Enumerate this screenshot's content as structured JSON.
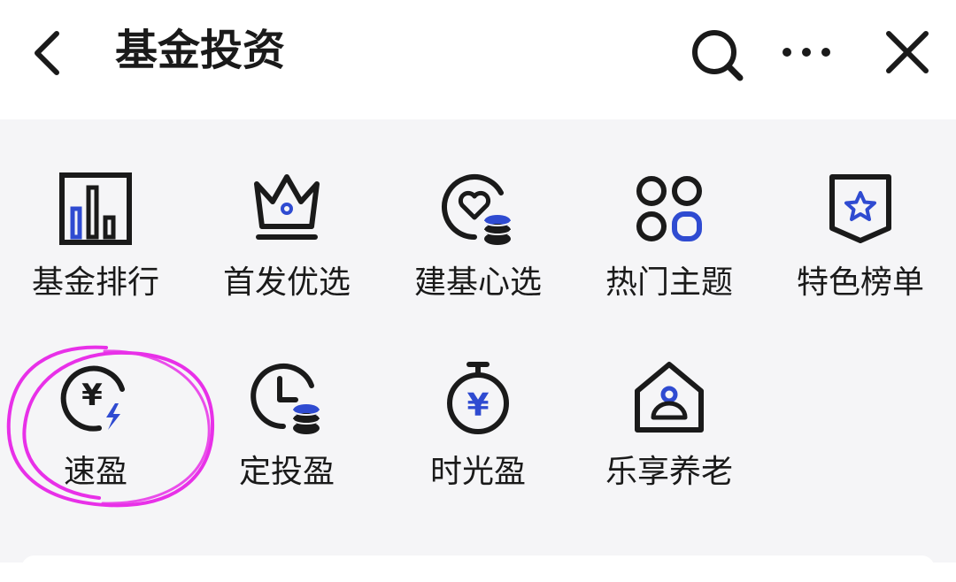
{
  "header": {
    "title": "基金投资",
    "back_icon": "chevron-left-icon",
    "search_icon": "search-icon",
    "more_icon": "more-dots-icon",
    "close_icon": "close-icon"
  },
  "colors": {
    "icon_dark": "#1a1a1a",
    "accent_blue": "#2f4bd1",
    "panel_bg": "#f5f5f7",
    "annotation_magenta": "#e830e8"
  },
  "grid": {
    "row1": [
      {
        "label": "基金排行",
        "icon": "bar-chart-icon"
      },
      {
        "label": "首发优选",
        "icon": "crown-icon"
      },
      {
        "label": "建基心选",
        "icon": "heart-coins-icon"
      },
      {
        "label": "热门主题",
        "icon": "four-petals-icon"
      },
      {
        "label": "特色榜单",
        "icon": "star-shield-icon"
      }
    ],
    "row2": [
      {
        "label": "速盈",
        "icon": "yen-lightning-icon"
      },
      {
        "label": "定投盈",
        "icon": "clock-coins-icon"
      },
      {
        "label": "时光盈",
        "icon": "stopwatch-yen-icon"
      },
      {
        "label": "乐享养老",
        "icon": "house-person-icon"
      }
    ]
  },
  "annotation": {
    "type": "hand-drawn circle",
    "target": "速盈"
  }
}
